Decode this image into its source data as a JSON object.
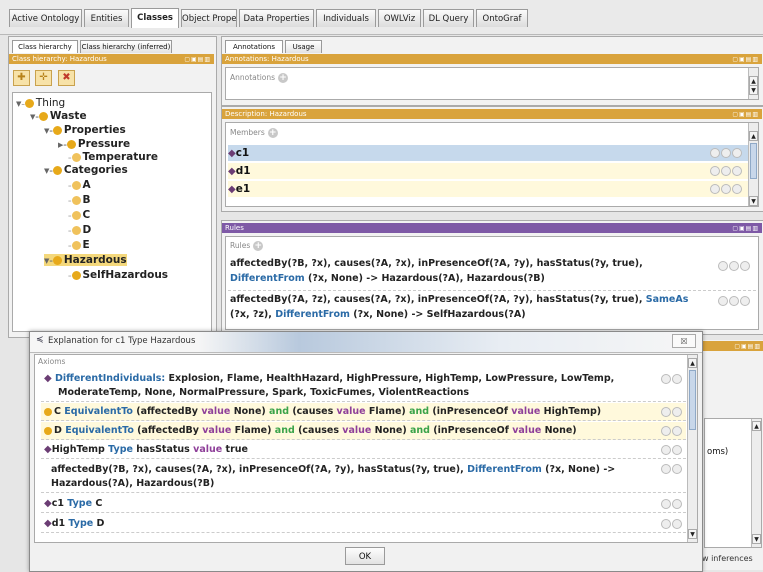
{
  "tabs": [
    "Active Ontology",
    "Entities",
    "Classes",
    "Object Properties",
    "Data Properties",
    "Individuals",
    "OWLViz",
    "DL Query",
    "OntoGraf"
  ],
  "active_tab": "Classes",
  "left_panel": {
    "subtabs": [
      "Class hierarchy",
      "Class hierarchy (inferred)"
    ],
    "header": "Class hierarchy: Hazardous",
    "tree": [
      {
        "label": "Thing",
        "level": 0
      },
      {
        "label": "Waste",
        "level": 1
      },
      {
        "label": "Properties",
        "level": 2
      },
      {
        "label": "Pressure",
        "level": 3
      },
      {
        "label": "Temperature",
        "level": 3
      },
      {
        "label": "Categories",
        "level": 2
      },
      {
        "label": "A",
        "level": 3
      },
      {
        "label": "B",
        "level": 3
      },
      {
        "label": "C",
        "level": 3
      },
      {
        "label": "D",
        "level": 3
      },
      {
        "label": "E",
        "level": 3
      },
      {
        "label": "Hazardous",
        "level": 2,
        "selected": true
      },
      {
        "label": "SelfHazardous",
        "level": 3
      }
    ]
  },
  "annotations_panel": {
    "subtabs": [
      "Annotations",
      "Usage"
    ],
    "header": "Annotations: Hazardous",
    "label": "Annotations"
  },
  "description_panel": {
    "header": "Description: Hazardous",
    "members_label": "Members",
    "members": [
      "c1",
      "d1",
      "e1"
    ]
  },
  "rules_panel": {
    "header": "Rules",
    "label": "Rules",
    "rule1": {
      "a": "affectedBy(?B, ?x), causes(?A, ?x), inPresenceOf(?A, ?y), hasStatus(?y, true),",
      "b": "DifferentFrom",
      "c": " (?x, None) -> Hazardous(?A), Hazardous(?B)"
    },
    "rule2": {
      "a": "affectedBy(?A, ?z), causes(?A, ?x), inPresenceOf(?A, ?y), hasStatus(?y, true), ",
      "b": "SameAs",
      "c": "(?x, ?z), ",
      "d": "DifferentFrom",
      "e": " (?x, None) -> SelfHazardous(?A)"
    }
  },
  "background_fragment": {
    "axioms_snippet": "oms)",
    "inferences_label": "w inferences"
  },
  "dialog": {
    "title": "Explanation for c1 Type Hazardous",
    "close": "☒",
    "axioms_label": "Axioms",
    "ok_label": "OK",
    "row1": {
      "kw": "DifferentIndividuals:",
      "text": " Explosion, Flame, HealthHazard, HighPressure, HighTemp, LowPressure, LowTemp,",
      "text2": "ModerateTemp, None, NormalPressure, Spark, ToxicFumes, ViolentReactions"
    },
    "row2": {
      "s": "C ",
      "eq": "EquivalentTo",
      "p1": " (affectedBy ",
      "v1": "value",
      "p2": " None) ",
      "and1": "and",
      "p3": " (causes ",
      "v2": "value",
      "p4": " Flame) ",
      "and2": "and",
      "p5": " (inPresenceOf ",
      "v3": "value",
      "p6": " HighTemp)"
    },
    "row3": {
      "s": "D ",
      "eq": "EquivalentTo",
      "p1": " (affectedBy ",
      "v1": "value",
      "p2": " Flame) ",
      "and1": "and",
      "p3": " (causes ",
      "v2": "value",
      "p4": " None) ",
      "and2": "and",
      "p5": " (inPresenceOf ",
      "v3": "value",
      "p6": " None)"
    },
    "row4": {
      "s": "HighTemp ",
      "type": "Type",
      "p1": " hasStatus ",
      "v": "value",
      "p2": " true"
    },
    "row5": {
      "a": "affectedBy(?B, ?x), causes(?A, ?x), inPresenceOf(?A, ?y), hasStatus(?y, true),  ",
      "b": "DifferentFrom",
      "c": " (?x, None) ->",
      "d": "Hazardous(?A), Hazardous(?B)"
    },
    "row6": {
      "s": "c1 ",
      "type": "Type",
      "o": " C"
    },
    "row7": {
      "s": "d1 ",
      "type": "Type",
      "o": " D"
    }
  },
  "colors": {
    "gold_header": "#d9a33c",
    "purple_header": "#7e59a6",
    "class_dot": "#e7a91a",
    "individual": "#6b3d74",
    "keyword_blue": "#2a6aa6",
    "keyword_purple": "#8e3f99",
    "keyword_green": "#3aa349"
  }
}
